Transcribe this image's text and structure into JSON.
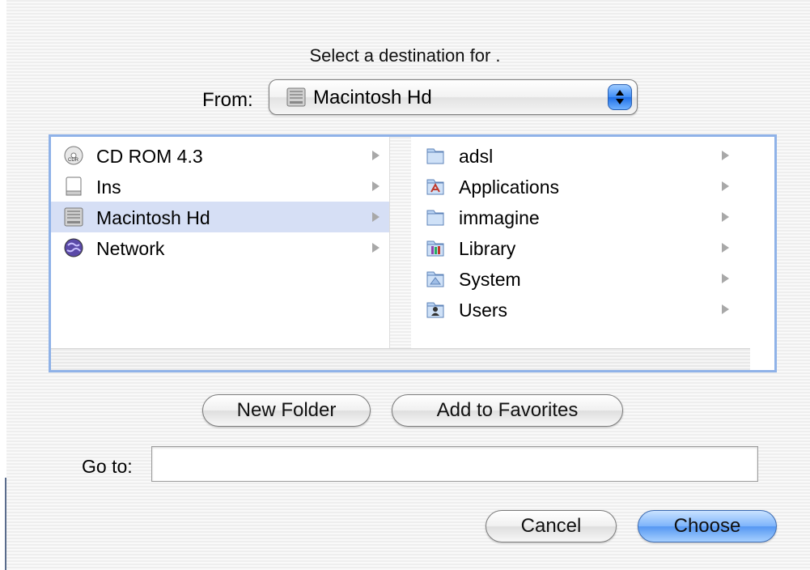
{
  "dialog": {
    "prompt": "Select a destination for .",
    "from_label": "From:",
    "from_value": "Macintosh Hd"
  },
  "browser": {
    "column1": [
      {
        "label": "CD ROM 4.3",
        "icon": "cd-rom-icon",
        "selected": false
      },
      {
        "label": "Ins",
        "icon": "disk-icon",
        "selected": false
      },
      {
        "label": "Macintosh Hd",
        "icon": "hard-drive-icon",
        "selected": true
      },
      {
        "label": "Network",
        "icon": "network-globe-icon",
        "selected": false
      }
    ],
    "column2": [
      {
        "label": "adsl",
        "icon": "folder-icon"
      },
      {
        "label": "Applications",
        "icon": "applications-folder-icon"
      },
      {
        "label": "immagine",
        "icon": "folder-icon"
      },
      {
        "label": "Library",
        "icon": "library-folder-icon"
      },
      {
        "label": "System",
        "icon": "system-folder-icon"
      },
      {
        "label": "Users",
        "icon": "users-folder-icon"
      }
    ]
  },
  "buttons": {
    "new_folder": "New Folder",
    "add_to_favorites": "Add to Favorites",
    "cancel": "Cancel",
    "choose": "Choose"
  },
  "goto": {
    "label": "Go to:",
    "value": ""
  },
  "colors": {
    "selection": "#d6dff5",
    "browser_border": "#8fb2e8",
    "default_button": "#5597f2"
  }
}
